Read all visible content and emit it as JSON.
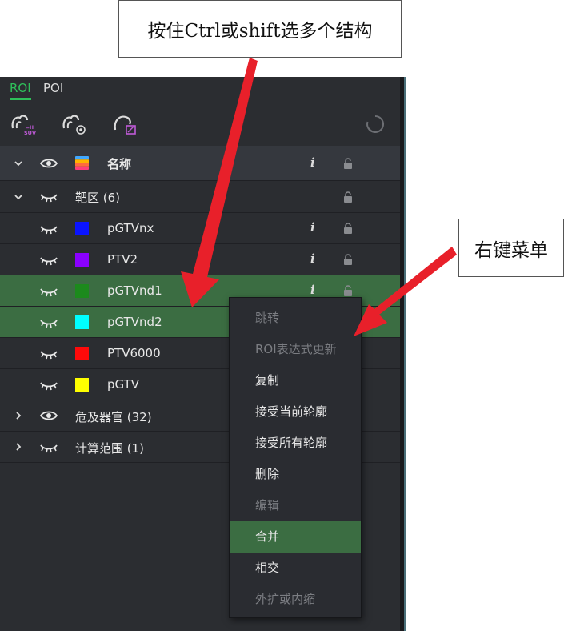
{
  "annotations": {
    "top_callout": "按住Ctrl或shift选多个结构",
    "right_callout": "右键菜单"
  },
  "tabs": [
    {
      "label": "ROI",
      "active": true
    },
    {
      "label": "POI",
      "active": false
    }
  ],
  "toolbar": {
    "icons": [
      "roi-suv-icon",
      "roi-settings-icon",
      "roi-edit-icon",
      "refresh-icon"
    ],
    "suv_badge": "SUV"
  },
  "list": {
    "header": {
      "name": "名称",
      "info": "i"
    },
    "groups": [
      {
        "label": "靶区 (6)",
        "expanded": true,
        "items": [
          {
            "name": "pGTVnx",
            "color": "#0a14ff",
            "selected": false,
            "info": "i"
          },
          {
            "name": "PTV2",
            "color": "#8a00ff",
            "selected": false,
            "info": "i"
          },
          {
            "name": "pGTVnd1",
            "color": "#1c8a1c",
            "selected": true,
            "info": "i"
          },
          {
            "name": "pGTVnd2",
            "color": "#00ffff",
            "selected": true,
            "info": ""
          },
          {
            "name": "PTV6000",
            "color": "#ff0a0a",
            "selected": false,
            "info": ""
          },
          {
            "name": "pGTV",
            "color": "#ffff00",
            "selected": false,
            "info": ""
          }
        ]
      },
      {
        "label": "危及器官 (32)",
        "expanded": false
      },
      {
        "label": "计算范围 (1)",
        "expanded": false
      }
    ]
  },
  "context_menu": {
    "items": [
      {
        "label": "跳转",
        "disabled": true
      },
      {
        "label": "ROI表达式更新",
        "disabled": true
      },
      {
        "label": "复制",
        "disabled": false
      },
      {
        "label": "接受当前轮廓",
        "disabled": false
      },
      {
        "label": "接受所有轮廓",
        "disabled": false
      },
      {
        "label": "删除",
        "disabled": false
      },
      {
        "label": "编辑",
        "disabled": true
      },
      {
        "label": "合并",
        "disabled": false,
        "highlighted": true
      },
      {
        "label": "相交",
        "disabled": false
      },
      {
        "label": "外扩或内缩",
        "disabled": true
      }
    ]
  },
  "colors": {
    "accent": "#2fbf5a",
    "selection": "#3b6d42",
    "panel_bg": "#2b2d31",
    "arrow": "#e8202a"
  }
}
